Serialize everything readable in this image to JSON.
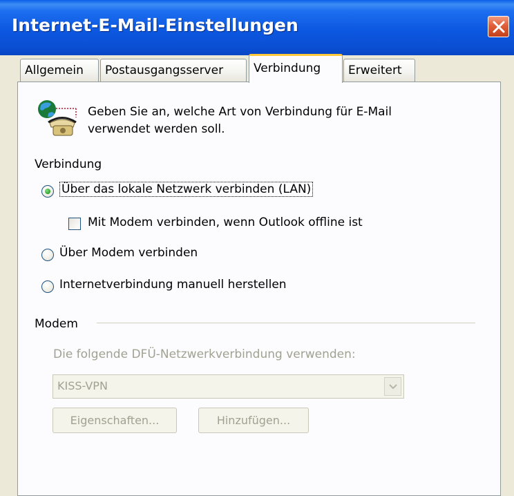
{
  "window": {
    "title": "Internet-E-Mail-Einstellungen"
  },
  "tabs": [
    {
      "label": "Allgemein",
      "active": false
    },
    {
      "label": "Postausgangsserver",
      "active": false
    },
    {
      "label": "Verbindung",
      "active": true
    },
    {
      "label": "Erweitert",
      "active": false
    }
  ],
  "intro": {
    "line1": "Geben Sie an, welche Art von Verbindung für E-Mail",
    "line2": "verwendet werden soll.",
    "icon": "globe-phone-icon"
  },
  "connection": {
    "group_label": "Verbindung",
    "lan": {
      "label": "Über das lokale Netzwerk verbinden (LAN)",
      "checked": true
    },
    "modem_offline": {
      "label": "Mit Modem verbinden, wenn Outlook offline ist",
      "checked": false
    },
    "modem": {
      "label": "Über Modem verbinden",
      "checked": false
    },
    "manual": {
      "label": "Internetverbindung manuell herstellen",
      "checked": false
    }
  },
  "modem_group": {
    "label": "Modem",
    "dialup_label": "Die folgende DFÜ-Netzwerkverbindung verwenden:",
    "dialup_value": "KISS-VPN",
    "properties_button": "Eigenschaften...",
    "add_button": "Hinzufügen..."
  },
  "colors": {
    "titlebar": "#0a5fe8",
    "close": "#e05f3b",
    "active_tab_accent": "#ffc83c",
    "disabled_text": "#a1a192"
  }
}
